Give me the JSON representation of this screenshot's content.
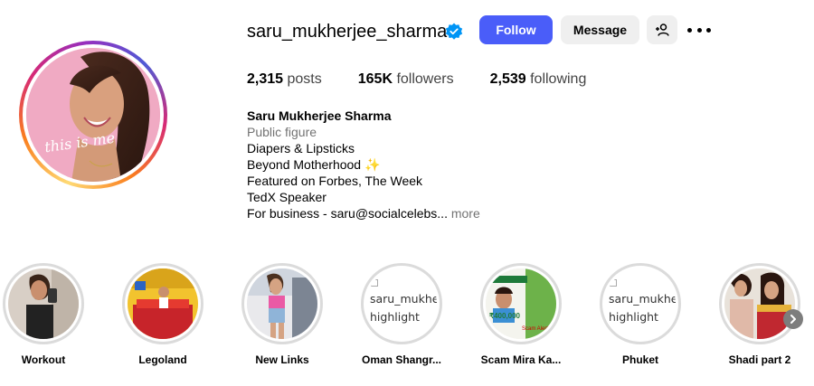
{
  "profile": {
    "username": "saru_mukherjee_sharma",
    "verified": true,
    "avatar_caption": "this is me",
    "follow_label": "Follow",
    "message_label": "Message",
    "stats": [
      {
        "value": "2,315",
        "label": "posts"
      },
      {
        "value": "165K",
        "label": "followers"
      },
      {
        "value": "2,539",
        "label": "following"
      }
    ],
    "bio": {
      "name": "Saru Mukherjee Sharma",
      "category": "Public figure",
      "lines": [
        "Diapers & Lipsticks",
        "Beyond Motherhood ✨",
        "Featured on Forbes, The Week",
        "TedX Speaker",
        "For business - saru@socialcelebs..."
      ],
      "more_label": "more"
    }
  },
  "highlights": [
    {
      "label": "Workout"
    },
    {
      "label": "Legoland"
    },
    {
      "label": "New Links"
    },
    {
      "label": "Oman Shangr...",
      "alt_text": "saru_mukherjee highlight story"
    },
    {
      "label": "Scam Mira Ka...",
      "thumb_price": "₹400,000",
      "thumb_tag": "Scam Alert !!"
    },
    {
      "label": "Phuket",
      "alt_text": "saru_mukherjee highlight story"
    },
    {
      "label": "Shadi part 2"
    }
  ],
  "colors": {
    "follow_blue": "#4a5df9",
    "verified_blue": "#0095f6",
    "secondary_button": "#efefef",
    "muted_text": "#737373",
    "ring_gray": "#dbdbdb"
  },
  "icons": [
    "verified-badge-icon",
    "add-person-icon",
    "more-options-icon",
    "chevron-right-icon"
  ]
}
